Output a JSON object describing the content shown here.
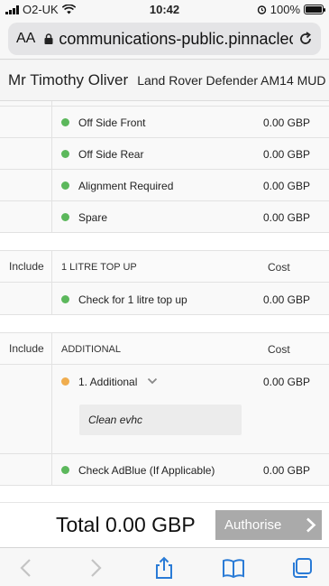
{
  "status_bar": {
    "carrier": "O2-UK",
    "time": "10:42",
    "battery": "100%",
    "battery_level": 1.0,
    "icons": [
      "signal-icon",
      "wifi-icon",
      "alarm-icon",
      "battery-icon"
    ]
  },
  "browser": {
    "reader_button": "AA",
    "url": "communications-public.pinnacleco",
    "icons": [
      "lock-icon",
      "reload-icon"
    ]
  },
  "customer": {
    "name": "Mr Timothy Oliver",
    "vehicle": "Land Rover Defender AM14 MUD"
  },
  "items_top": [
    {
      "label": "Off Side Front",
      "price": "0.00 GBP",
      "status": "green"
    },
    {
      "label": "Off Side Rear",
      "price": "0.00 GBP",
      "status": "green"
    },
    {
      "label": "Alignment Required",
      "price": "0.00 GBP",
      "status": "green"
    },
    {
      "label": "Spare",
      "price": "0.00 GBP",
      "status": "green"
    }
  ],
  "section_topup": {
    "include": "Include",
    "title": "1 LITRE TOP UP",
    "cost": "Cost",
    "items": [
      {
        "label": "Check for 1 litre top up",
        "price": "0.00 GBP",
        "status": "green"
      }
    ]
  },
  "section_additional": {
    "include": "Include",
    "title": "ADDITIONAL",
    "cost": "Cost",
    "item_expanded": {
      "label": "1. Additional",
      "price": "0.00 GBP",
      "status": "amber",
      "note": "Clean evhc"
    },
    "items": [
      {
        "label": "Check AdBlue (If Applicable)",
        "price": "0.00 GBP",
        "status": "green"
      }
    ]
  },
  "footer": {
    "total": "Total 0.00 GBP",
    "authorise": "Authorise"
  },
  "toolbar_icons": [
    "back-icon",
    "forward-icon",
    "share-icon",
    "bookmarks-icon",
    "tabs-icon"
  ],
  "colors": {
    "status_green": "#5cb85c",
    "status_amber": "#f0ad4e",
    "authorise_bg": "#aaaaaa"
  }
}
